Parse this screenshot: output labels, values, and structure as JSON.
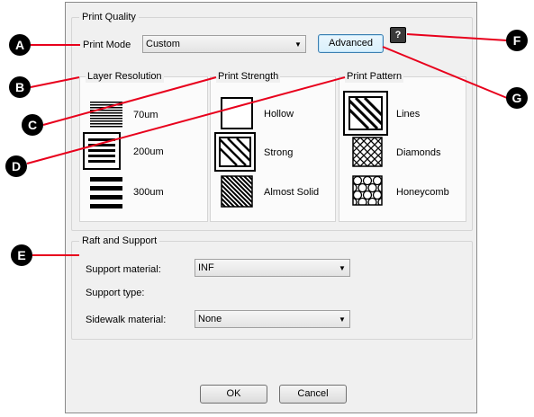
{
  "print_quality": {
    "legend": "Print Quality",
    "print_mode_label": "Print Mode",
    "print_mode_value": "Custom",
    "advanced_label": "Advanced",
    "help_symbol": "?",
    "layer_resolution": {
      "legend": "Layer Resolution",
      "options": [
        "70um",
        "200um",
        "300um"
      ],
      "selected": "200um"
    },
    "print_strength": {
      "legend": "Print Strength",
      "options": [
        "Hollow",
        "Strong",
        "Almost Solid"
      ],
      "selected": "Strong"
    },
    "print_pattern": {
      "legend": "Print Pattern",
      "options": [
        "Lines",
        "Diamonds",
        "Honeycomb"
      ],
      "selected": "Lines"
    }
  },
  "raft_support": {
    "legend": "Raft and Support",
    "support_material_label": "Support material:",
    "support_material_value": "INF",
    "support_type_label": "Support type:",
    "sidewalk_material_label": "Sidewalk material:",
    "sidewalk_material_value": "None"
  },
  "buttons": {
    "ok": "OK",
    "cancel": "Cancel"
  },
  "callouts": [
    "A",
    "B",
    "C",
    "D",
    "E",
    "F",
    "G"
  ],
  "colors": {
    "callout_line": "#e8001c",
    "callout_circle": "#000000"
  }
}
